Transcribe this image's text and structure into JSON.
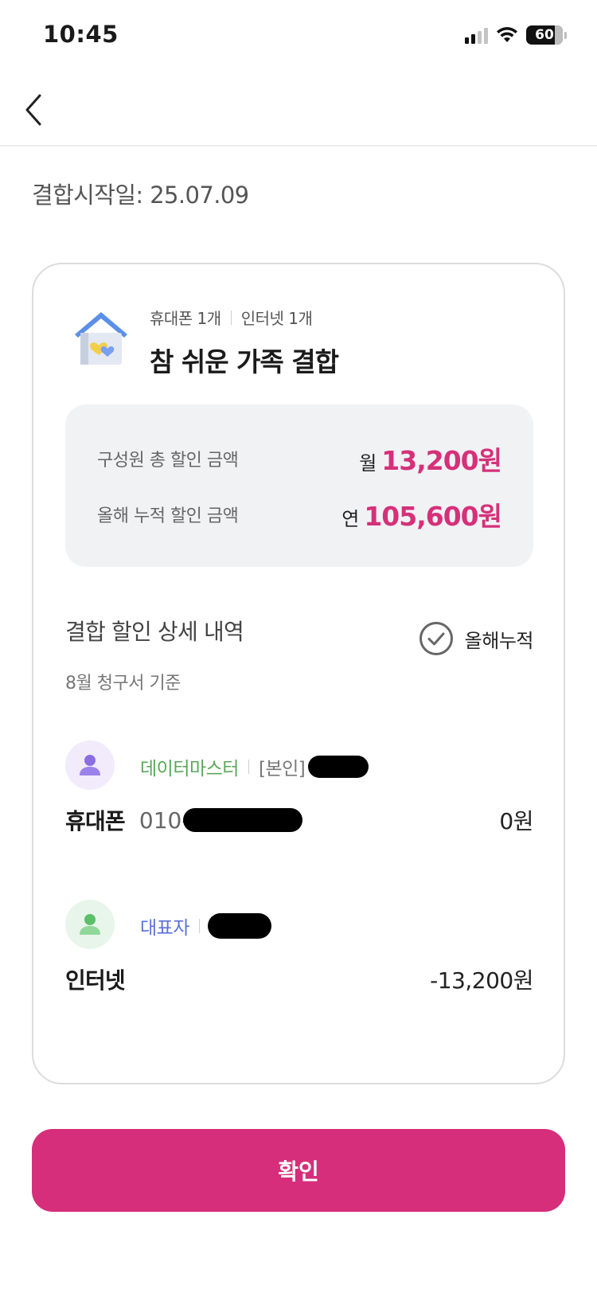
{
  "status_bar": {
    "time": "10:45",
    "battery": "60"
  },
  "start_date": "결합시작일: 25.07.09",
  "plan": {
    "products": [
      "휴대폰 1개",
      "인터넷 1개"
    ],
    "title": "참 쉬운 가족 결합"
  },
  "summary": {
    "monthly_label": "구성원 총 할인 금액",
    "monthly_prefix": "월",
    "monthly_amount": "13,200원",
    "yearly_label": "올해 누적 할인 금액",
    "yearly_prefix": "연",
    "yearly_amount": "105,600원"
  },
  "details": {
    "title": "결합 할인 상세 내역",
    "subtitle": "8월 청구서 기준",
    "yearly_toggle_label": "올해누적"
  },
  "members": [
    {
      "plan_name": "데이터마스터",
      "role": "[본인]",
      "service": "휴대폰",
      "phone_prefix": "010-",
      "amount": "0원"
    },
    {
      "plan_name": "대표자",
      "service": "인터넷",
      "amount": "-13,200원"
    }
  ],
  "confirm_label": "확인",
  "colors": {
    "accent": "#d62e7a",
    "amount": "#d6307a",
    "plan_green": "#5aa85a",
    "plan_blue": "#5b72d8"
  }
}
